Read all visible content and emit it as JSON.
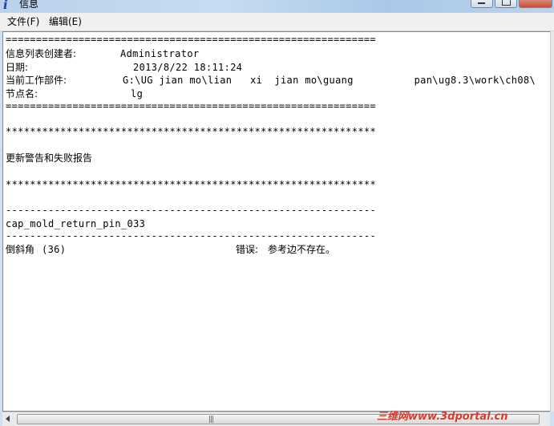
{
  "window": {
    "title": "信息"
  },
  "menu": {
    "file": "文件(F)",
    "edit": "编辑(E)"
  },
  "report": {
    "sep_eq": "=============================================================",
    "creator_label": "信息列表创建者:",
    "creator_value": "Administrator",
    "date_label": "日期:",
    "date_value": "2013/8/22 18:11:24",
    "part_label": "当前工作部件:",
    "part_value": "G:\\UG jian mo\\lian   xi  jian mo\\guang          pan\\ug8.3\\work\\ch08\\",
    "node_label": "节点名:",
    "node_value": "lg",
    "sep_star": "*************************************************************",
    "section_title": "更新警告和失败报告",
    "sep_dash": "-------------------------------------------------------------",
    "feature_name": "cap_mold_return_pin_033",
    "feature_label": "倒斜角",
    "feature_id": "(36)",
    "error_label": "错误:",
    "error_text": "参考边不存在。"
  },
  "scrollbar": {
    "grip": "|||"
  },
  "watermark": {
    "text": "三维网www.3dportal.cn"
  },
  "colors": {
    "title_gradient": "#b9d1ea",
    "watermark": "#d93a2b"
  }
}
